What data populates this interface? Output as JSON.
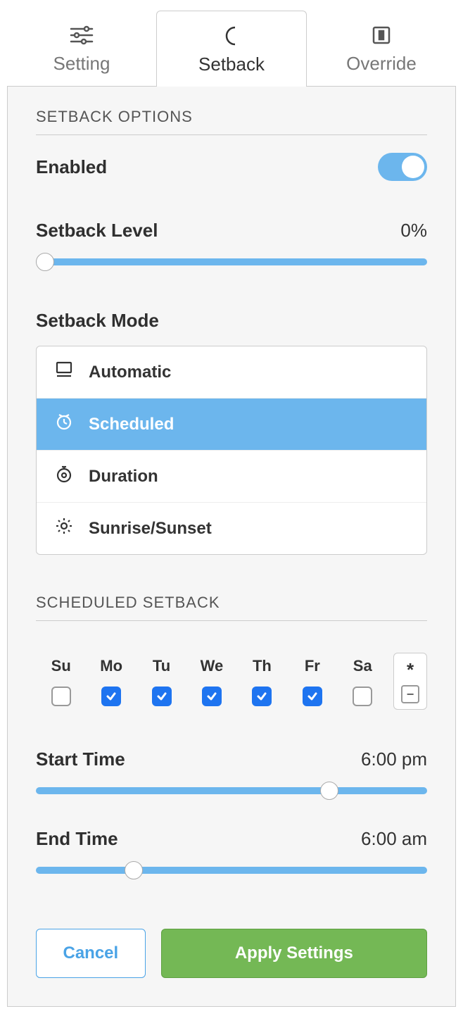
{
  "tabs": {
    "setting": "Setting",
    "setback": "Setback",
    "override": "Override"
  },
  "section1_title": "SETBACK OPTIONS",
  "enabled_label": "Enabled",
  "enabled_value": true,
  "setback_level": {
    "label": "Setback Level",
    "value": "0%",
    "pct": 0
  },
  "setback_mode": {
    "label": "Setback Mode",
    "options": {
      "automatic": "Automatic",
      "scheduled": "Scheduled",
      "duration": "Duration",
      "sunrise": "Sunrise/Sunset"
    },
    "selected": "scheduled"
  },
  "section2_title": "SCHEDULED SETBACK",
  "days": [
    {
      "abbr": "Su",
      "checked": false
    },
    {
      "abbr": "Mo",
      "checked": true
    },
    {
      "abbr": "Tu",
      "checked": true
    },
    {
      "abbr": "We",
      "checked": true
    },
    {
      "abbr": "Th",
      "checked": true
    },
    {
      "abbr": "Fr",
      "checked": true
    },
    {
      "abbr": "Sa",
      "checked": false
    }
  ],
  "all_days_symbol": "*",
  "all_days_indeterminate": "−",
  "start_time": {
    "label": "Start Time",
    "value": "6:00 pm",
    "pct": 75
  },
  "end_time": {
    "label": "End Time",
    "value": "6:00 am",
    "pct": 25
  },
  "buttons": {
    "cancel": "Cancel",
    "apply": "Apply Settings"
  }
}
